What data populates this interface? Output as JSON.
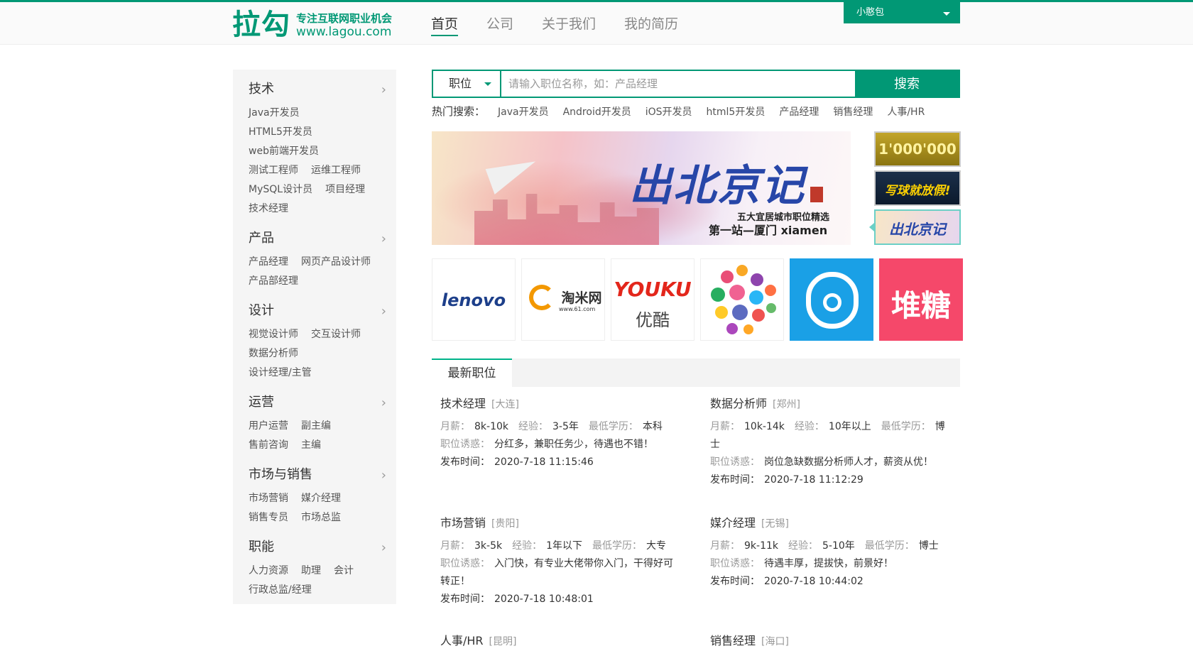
{
  "header": {
    "logo_main": "拉勾",
    "logo_slogan": "专注互联网职业机会",
    "logo_url": "www.lagou.com",
    "nav": [
      "首页",
      "公司",
      "关于我们",
      "我的简历"
    ],
    "user": "小憨包"
  },
  "sidebar": [
    {
      "title": "技术",
      "links": [
        "Java开发员",
        "HTML5开发员",
        "web前端开发员",
        "测试工程师",
        "运维工程师",
        "MySQL设计员",
        "项目经理",
        "技术经理"
      ]
    },
    {
      "title": "产品",
      "links": [
        "产品经理",
        "网页产品设计师",
        "产品部经理"
      ]
    },
    {
      "title": "设计",
      "links": [
        "视觉设计师",
        "交互设计师",
        "数据分析师",
        "设计经理/主管"
      ]
    },
    {
      "title": "运营",
      "links": [
        "用户运营",
        "副主编",
        "售前咨询",
        "主编"
      ]
    },
    {
      "title": "市场与销售",
      "links": [
        "市场营销",
        "媒介经理",
        "销售专员",
        "市场总监"
      ]
    },
    {
      "title": "职能",
      "links": [
        "人力资源",
        "助理",
        "会计",
        "行政总监/经理"
      ]
    }
  ],
  "search": {
    "type": "职位",
    "placeholder": "请输入职位名称，如：产品经理",
    "button": "搜索",
    "hot_label": "热门搜索：",
    "hot": [
      "Java开发员",
      "Android开发员",
      "iOS开发员",
      "html5开发员",
      "产品经理",
      "销售经理",
      "人事/HR"
    ]
  },
  "banner": {
    "title": "出北京记",
    "sub1": "五大宜居城市职位精选",
    "sub2": "第一站—厦门 xiamen"
  },
  "thumbs": [
    "1'000'000",
    "写球就放假!",
    "出北京记"
  ],
  "companies": {
    "lenovo": "lenovo",
    "taomi": "淘米网",
    "taomi_url": "www.61.com",
    "youku": "YOUKU",
    "youku_cn": "优酷",
    "duitang": "堆糖"
  },
  "tab": "最新职位",
  "labels": {
    "salary": "月薪：",
    "exp": "经验：",
    "edu": "最低学历：",
    "perk": "职位诱惑：",
    "time": "发布时间："
  },
  "jobs": [
    {
      "title": "技术经理",
      "city": "[大连]",
      "salary": "8k-10k",
      "exp": "3-5年",
      "edu": "本科",
      "perk": "分红多，兼职任务少，待遇也不错！",
      "time": "2020-7-18 11:15:46"
    },
    {
      "title": "数据分析师",
      "city": "[郑州]",
      "salary": "10k-14k",
      "exp": "10年以上",
      "edu": "博士",
      "perk": "岗位急缺数据分析师人才，薪资从优！",
      "time": "2020-7-18 11:12:29"
    },
    {
      "title": "市场营销",
      "city": "[贵阳]",
      "salary": "3k-5k",
      "exp": "1年以下",
      "edu": "大专",
      "perk": "入门快，有专业大佬带你入门，干得好可转正！",
      "time": "2020-7-18 10:48:01"
    },
    {
      "title": "媒介经理",
      "city": "[无锡]",
      "salary": "9k-11k",
      "exp": "5-10年",
      "edu": "博士",
      "perk": "待遇丰厚，提拔快，前景好！",
      "time": "2020-7-18 10:44:02"
    },
    {
      "title": "人事/HR",
      "city": "[昆明]"
    },
    {
      "title": "销售经理",
      "city": "[海口]"
    }
  ],
  "colors": {
    "brand": "#019875",
    "accent": "#00b38a"
  }
}
